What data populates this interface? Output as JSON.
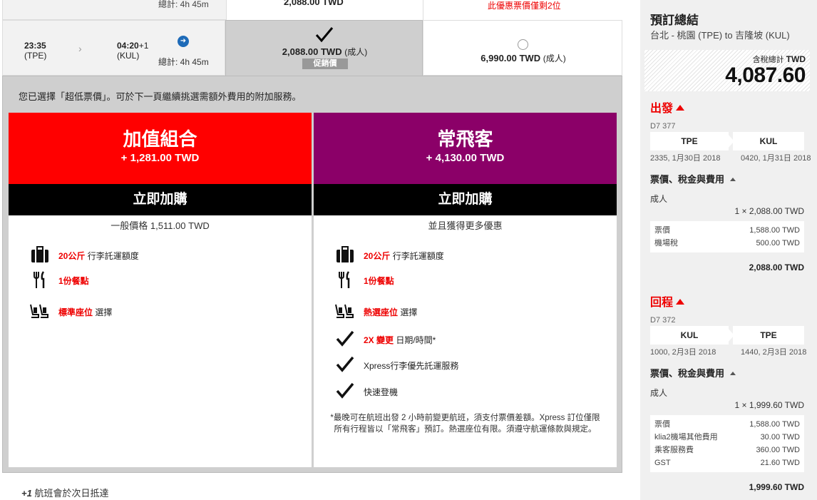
{
  "prev_row": {
    "duration": "總計: 4h 45m",
    "price": "2,088.00 TWD",
    "warning": "此優惠票價僅剩2位"
  },
  "flight": {
    "dep_time": "23:35",
    "dep_code": "(TPE)",
    "arr_time": "04:20",
    "arr_plus": "+1",
    "arr_code": "(KUL)",
    "duration": "總計: 4h 45m",
    "selected_price": "2,088.00 TWD",
    "selected_unit": "(成人)",
    "promo_label": "促銷價",
    "other_price": "6,990.00 TWD",
    "other_unit": "(成人)"
  },
  "panel": {
    "note": "您已選擇「超低票價」。可於下一頁繼續挑選需額外費用的附加服務。"
  },
  "value_pack": {
    "title": "加值組合",
    "price": "+ 1,281.00 TWD",
    "button": "立即加購",
    "subtext": "一般價格 1,511.00 TWD",
    "features": [
      {
        "hl": "20公斤",
        "text": " 行李託運額度",
        "icon": "luggage-icon"
      },
      {
        "hl": "1份餐點",
        "text": "",
        "icon": "meal-icon"
      },
      {
        "hl": "標準座位",
        "text": " 選擇",
        "icon": "seat-icon"
      }
    ]
  },
  "flex_pack": {
    "title": "常飛客",
    "price": "+ 4,130.00 TWD",
    "button": "立即加購",
    "subtext": "並且獲得更多優惠",
    "features": [
      {
        "hl": "20公斤",
        "text": " 行李託運額度",
        "icon": "luggage-icon"
      },
      {
        "hl": "1份餐點",
        "text": "",
        "icon": "meal-icon"
      },
      {
        "hl": "熱選座位",
        "text": " 選擇",
        "icon": "seat-icon"
      },
      {
        "hl": "2X 變更",
        "text": " 日期/時間*",
        "icon": "check-icon"
      },
      {
        "hl": "",
        "text": "Xpress行李優先託運服務",
        "icon": "check-icon"
      },
      {
        "hl": "",
        "text": "快速登機",
        "icon": "check-icon"
      }
    ],
    "footnote_1": "*最晚可在航班出發 2 小時前變更航班，須支付票價差額。Xpress 訂位僅限",
    "footnote_2": "所有行程皆以「常飛客」預訂。熱選座位有限。須遵守航運條款與規定。"
  },
  "next_day_prefix": "+1",
  "next_day_text": " 航班會於次日抵達",
  "summary": {
    "title": "預訂總結",
    "route": "台北 - 桃園 (TPE) to 吉隆坡 (KUL)",
    "total_label": "含稅總計",
    "total_currency": "TWD",
    "total_amount": "4,087.60",
    "outbound": {
      "heading": "出發",
      "flight_no": "D7 377",
      "from": "TPE",
      "to": "KUL",
      "dep": "2335, 1月30日 2018",
      "arr": "0420, 1月31日 2018",
      "fees_heading": "票價、稅金與費用",
      "pax": "成人",
      "qty": "1 × 2,088.00 TWD",
      "breakdown": [
        {
          "label": "票價",
          "value": "1,588.00 TWD"
        },
        {
          "label": "機場稅",
          "value": "500.00 TWD"
        }
      ],
      "subtotal": "2,088.00 TWD"
    },
    "return": {
      "heading": "回程",
      "flight_no": "D7 372",
      "from": "KUL",
      "to": "TPE",
      "dep": "1000, 2月3日 2018",
      "arr": "1440, 2月3日 2018",
      "fees_heading": "票價、稅金與費用",
      "pax": "成人",
      "qty": "1 × 1,999.60 TWD",
      "breakdown": [
        {
          "label": "票價",
          "value": "1,588.00 TWD"
        },
        {
          "label": "klia2機場其他費用",
          "value": "30.00 TWD"
        },
        {
          "label": "乘客服務費",
          "value": "360.00 TWD"
        },
        {
          "label": "GST",
          "value": "21.60 TWD"
        }
      ],
      "subtotal": "1,999.60 TWD"
    }
  }
}
